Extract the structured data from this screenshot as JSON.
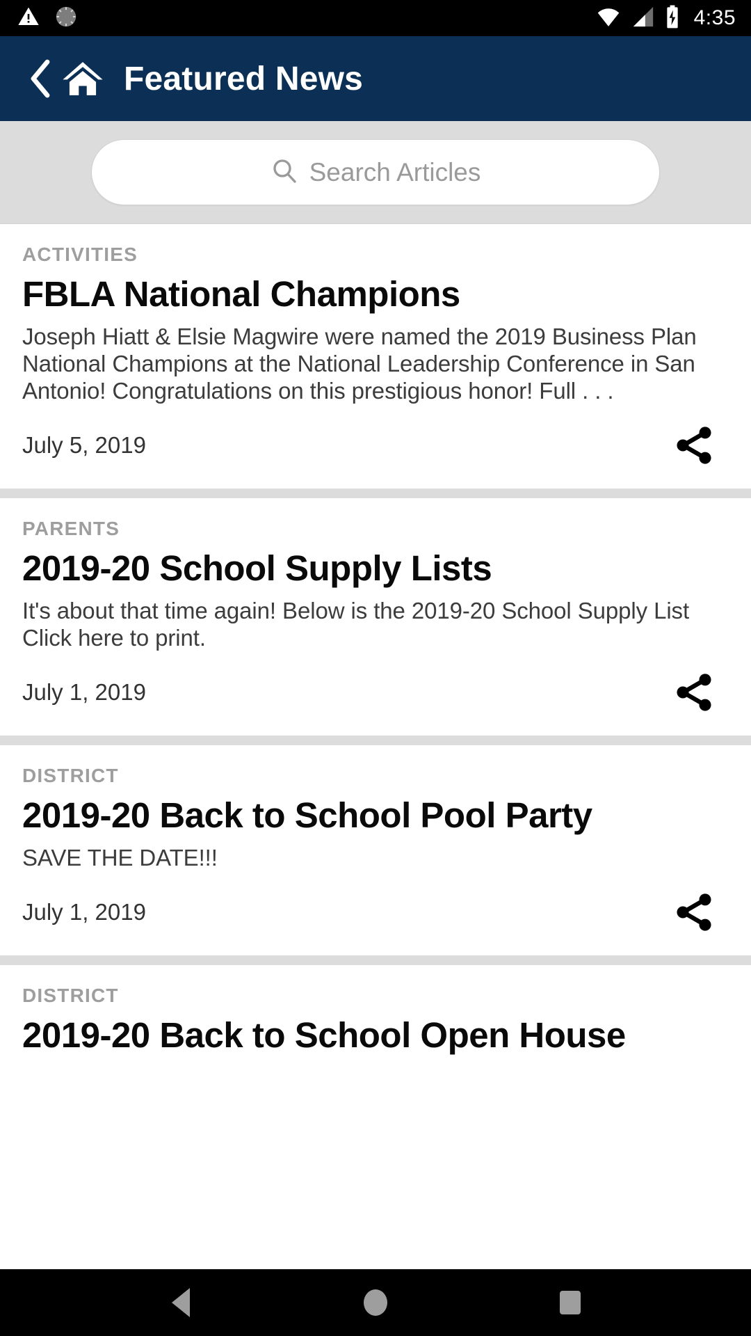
{
  "status_bar": {
    "icons_left": [
      "warning-triangle-icon",
      "sync-spinner-icon"
    ],
    "icons_right": [
      "wifi-icon",
      "cell-signal-icon",
      "battery-charging-icon"
    ],
    "time": "4:35"
  },
  "app_bar": {
    "back_icon": "chevron-left-icon",
    "home_icon": "home-icon",
    "title": "Featured News",
    "background_color": "#0c3055"
  },
  "search": {
    "placeholder": "Search Articles",
    "value": "",
    "icon": "search-icon"
  },
  "articles": [
    {
      "category": "ACTIVITIES",
      "headline": "FBLA National Champions",
      "summary": "Joseph Hiatt & Elsie Magwire were named the 2019 Business Plan National Champions at the National Leadership Conference in San Antonio! Congratulations on this prestigious honor! Full . . .",
      "date": "July 5, 2019",
      "share_icon": "share-icon"
    },
    {
      "category": "PARENTS",
      "headline": "2019-20 School Supply Lists",
      "summary": "It's about that time again! Below is the 2019-20 School Supply List Click here to print.",
      "date": "July 1, 2019",
      "share_icon": "share-icon"
    },
    {
      "category": "DISTRICT",
      "headline": "2019-20 Back to School Pool Party",
      "summary": "SAVE THE DATE!!!",
      "date": "July 1, 2019",
      "share_icon": "share-icon"
    },
    {
      "category": "DISTRICT",
      "headline": "2019-20 Back to School Open House",
      "summary": "",
      "date": "",
      "share_icon": "share-icon"
    }
  ],
  "nav_bar": {
    "back": "nav-back-icon",
    "home": "nav-home-icon",
    "recents": "nav-recents-icon"
  }
}
